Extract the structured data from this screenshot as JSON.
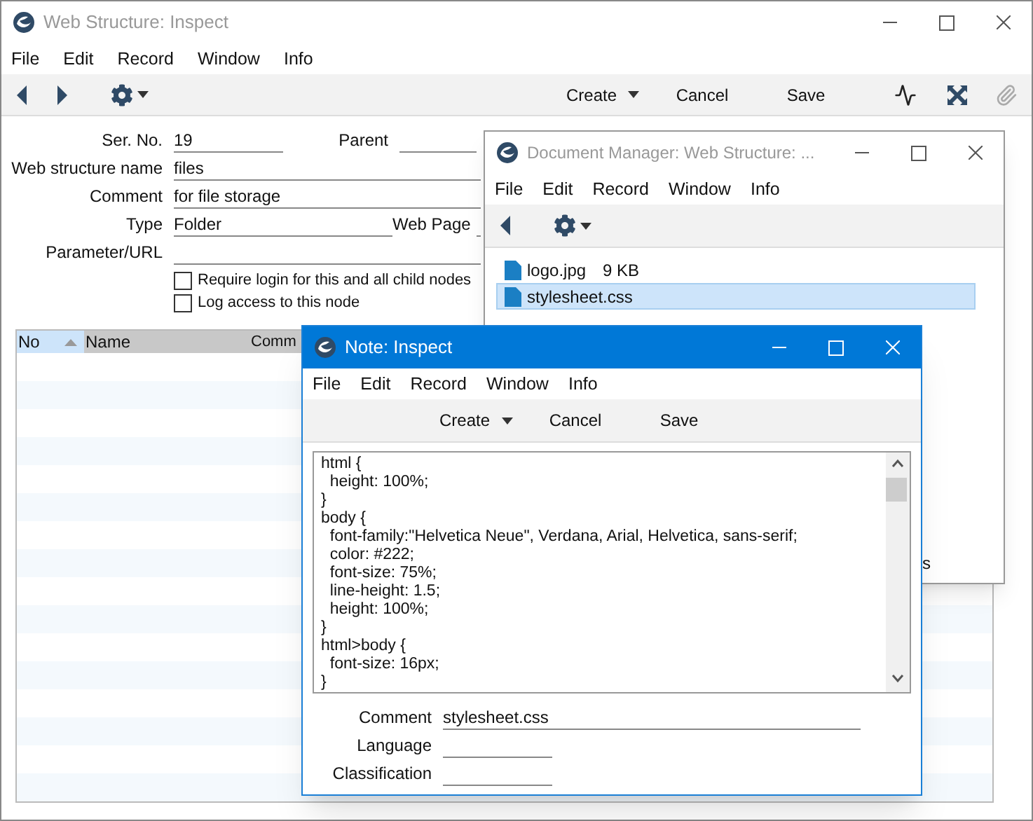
{
  "main_window": {
    "title": "Web Structure: Inspect",
    "menu": [
      "File",
      "Edit",
      "Record",
      "Window",
      "Info"
    ],
    "toolbar": [
      "Create",
      "Cancel",
      "Save"
    ],
    "ser_no": {
      "label": "Ser. No.",
      "value": "19"
    },
    "parent": {
      "label": "Parent"
    },
    "name": {
      "label": "Web structure name",
      "value": "files"
    },
    "comment": {
      "label": "Comment",
      "value": "for file storage"
    },
    "type": {
      "label": "Type",
      "value": "Folder"
    },
    "web_page": {
      "label": "Web Page"
    },
    "parameter_url": {
      "label": "Parameter/URL"
    },
    "checkboxes": [
      {
        "label": "Require login for this and all child nodes",
        "checked": false
      },
      {
        "label": "Log access to this node",
        "checked": false
      }
    ],
    "table": {
      "columns": [
        {
          "label": "No",
          "sorted": true
        },
        {
          "label": "Name",
          "sorted": false
        },
        {
          "label": "Comm",
          "sorted": false
        }
      ]
    }
  },
  "document_manager": {
    "title": "Document Manager: Web Structure: ...",
    "menu": [
      "File",
      "Edit",
      "Record",
      "Window",
      "Info"
    ],
    "files": [
      {
        "name": "logo.jpg",
        "size": "9 KB",
        "selected": false
      },
      {
        "name": "stylesheet.css",
        "selected": true
      }
    ],
    "cut_text": "s"
  },
  "note_window": {
    "title": "Note: Inspect",
    "menu": [
      "File",
      "Edit",
      "Record",
      "Window",
      "Info"
    ],
    "toolbar": [
      "Create",
      "Cancel",
      "Save"
    ],
    "text": [
      "html {",
      "  height: 100%;",
      "}",
      "body {",
      "  font-family:\"Helvetica Neue\", Verdana, Arial, Helvetica, sans-serif;",
      "  color: #222;",
      "  font-size: 75%;",
      "  line-height: 1.5;",
      "  height: 100%;",
      "}",
      "html>body {",
      "  font-size: 16px;",
      "}"
    ],
    "comment": {
      "label": "Comment",
      "value": "stylesheet.css"
    },
    "language": {
      "label": "Language"
    },
    "classification": {
      "label": "Classification"
    }
  }
}
